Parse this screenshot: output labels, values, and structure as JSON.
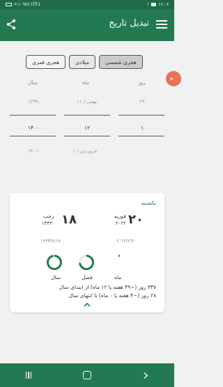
{
  "status": {
    "time": "۱۶:۰۷",
    "left_indicator": "۱",
    "signal_label": "Vo) LTE1",
    "battery": "۶۱٪"
  },
  "appbar": {
    "title": "تبدیل تاریخ"
  },
  "tabs": [
    {
      "label": "هجری شمسی",
      "selected": true
    },
    {
      "label": "میلادی",
      "selected": false
    },
    {
      "label": "هجری قمری",
      "selected": false
    }
  ],
  "picker": {
    "headers": {
      "day": "روز",
      "month": "ماه",
      "year": "سال"
    },
    "prev": {
      "day": "۲۹",
      "month": "بهمن / ۱۱",
      "year": "۱۳۹۹"
    },
    "current": {
      "day": "۱",
      "month": "۱۲",
      "year": "۱۴۰۰"
    },
    "next": {
      "day": "",
      "month": "فروردین / ۱",
      "year": "۱۴۰۱"
    }
  },
  "card": {
    "weekday": "یکشنبه",
    "gregorian": {
      "day": "۲۰",
      "month": "فوریه",
      "year": "۲۰۲۲",
      "short": "۲۰۲۲/۲/۲۰"
    },
    "hijri": {
      "day": "۱۸",
      "month": "رجب",
      "year": "۱۴۴۳",
      "short": "۱۴۴۳/۷/۱۸"
    },
    "progress_labels": {
      "year": "سال",
      "season": "فصل",
      "month": "ماه"
    },
    "progress": {
      "year": 0.97,
      "season": 0.73,
      "month": 0.03
    },
    "line1": "۳۳۷ روز (~۴۹ هفته یا ۱۲ ماه) از ابتدای سال",
    "line2": "۲۸ روز (~۴ هفته یا ۰ ماه) تا انتهای سال"
  },
  "colors": {
    "primary": "#237a50",
    "accent_fab": "#e8735a"
  }
}
